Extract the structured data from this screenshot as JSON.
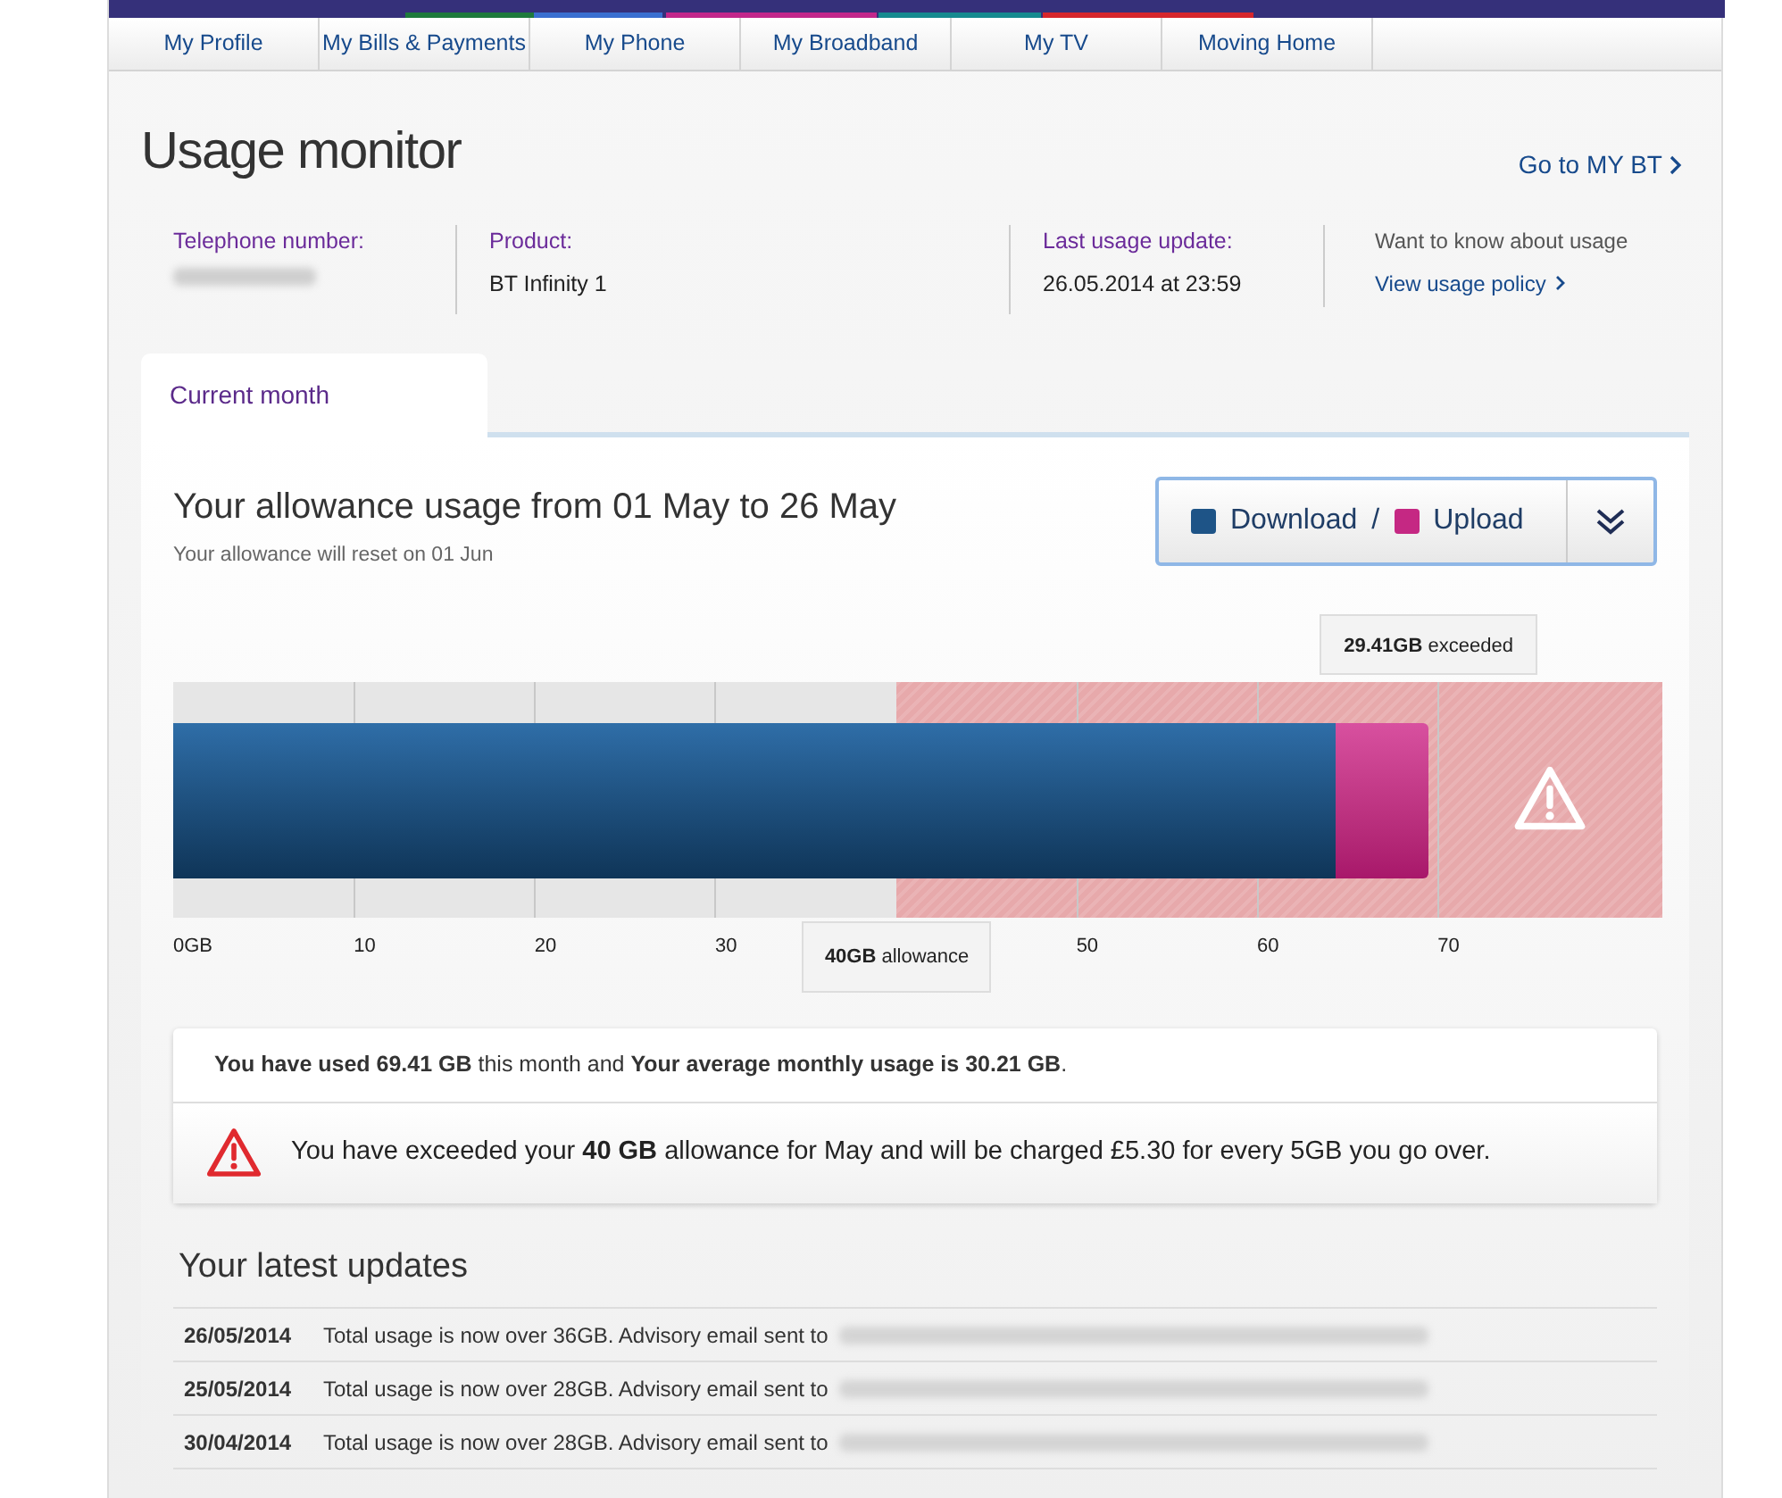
{
  "nav": {
    "tabs": [
      {
        "label": "My Profile"
      },
      {
        "label": "My Bills & Payments"
      },
      {
        "label": "My Phone"
      },
      {
        "label": "My Broadband"
      },
      {
        "label": "My TV"
      },
      {
        "label": "Moving Home"
      }
    ]
  },
  "header": {
    "title": "Usage monitor",
    "link": "Go to MY BT"
  },
  "info": {
    "telephone_label": "Telephone number:",
    "product_label": "Product:",
    "product": "BT Infinity 1",
    "update_label": "Last usage update:",
    "update": "26.05.2014 at 23:59",
    "policy_text": "Want to know about usage",
    "policy_link": "View usage policy"
  },
  "tabs": [
    {
      "label": "Current month",
      "selected": true
    }
  ],
  "usage": {
    "title": "Your allowance usage from 01 May to 26 May",
    "subtitle": "Your allowance will reset on 01 Jun",
    "legend": {
      "download": "Download",
      "separator": "/",
      "upload": "Upload"
    },
    "download": {
      "level": 0.78
    },
    "upload": {
      "level": 0.843
    },
    "allowance": {
      "level": 0.486,
      "label": "**40GB** allowance"
    },
    "exceeded_label": "**29.41GB** exceeded",
    "ticks_below_allowance": [
      "0GB",
      "10",
      "20",
      "30"
    ],
    "ticks_above_allowance": [
      "50",
      "60",
      "70"
    ]
  },
  "summary": {
    "used": "**You have used 69.41 GB** this month and **Your average monthly usage is 30.21 GB**.",
    "warning": "You have exceeded your **40 GB** allowance for May and will be charged £5.30 for every 5GB you go over."
  },
  "updates": {
    "title": "Your latest updates",
    "rows": [
      {
        "date": "26/05/2014",
        "text": "Total usage is now over 36GB. Advisory email sent to"
      },
      {
        "date": "25/05/2014",
        "text": "Total usage is now over 28GB. Advisory email sent to"
      },
      {
        "date": "30/04/2014",
        "text": "Total usage is now over 28GB. Advisory email sent to"
      }
    ]
  }
}
